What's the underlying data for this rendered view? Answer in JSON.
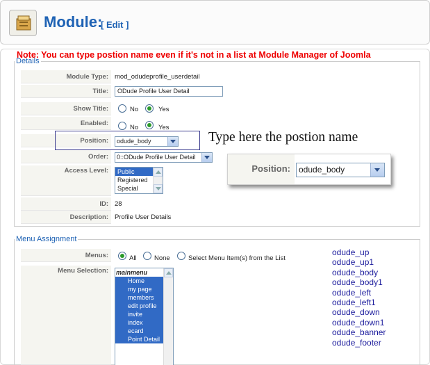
{
  "header": {
    "title": "Module:",
    "edit_tag": "[ Edit ]"
  },
  "note": "Note: You can type postion name even if it's not in a list at Module Manager of Joomla",
  "details": {
    "legend": "Details",
    "module_type": {
      "label": "Module Type:",
      "value": "mod_odudeprofile_userdetail"
    },
    "title": {
      "label": "Title:",
      "value": "ODude Profile User Detail"
    },
    "show_title": {
      "label": "Show Title:",
      "no": "No",
      "yes": "Yes",
      "selected": "Yes"
    },
    "enabled": {
      "label": "Enabled:",
      "no": "No",
      "yes": "Yes",
      "selected": "Yes"
    },
    "position": {
      "label": "Position:",
      "value": "odude_body"
    },
    "order": {
      "label": "Order:",
      "value": "0::ODude Profile User Detail"
    },
    "access_level": {
      "label": "Access Level:",
      "options": [
        "Public",
        "Registered",
        "Special"
      ],
      "selected": "Public"
    },
    "id": {
      "label": "ID:",
      "value": "28"
    },
    "description": {
      "label": "Description:",
      "value": "Profile User Details"
    }
  },
  "annotation": "Type here the postion name",
  "zoom": {
    "label": "Position:",
    "value": "odude_body"
  },
  "menu_assignment": {
    "legend": "Menu Assignment",
    "menus": {
      "label": "Menus:",
      "all": "All",
      "none": "None",
      "select": "Select Menu Item(s) from the List",
      "selected": "All"
    },
    "menu_selection": {
      "label": "Menu Selection:",
      "group": "mainmenu",
      "items": [
        "Home",
        "my page",
        "members",
        "edit profile",
        "invite",
        "index",
        "ecard",
        "Point Detail"
      ]
    }
  },
  "positions": [
    "odude_up",
    "odude_up1",
    "odude_body",
    "odude_body1",
    "odude_left",
    "odude_left1",
    "odude_down",
    "odude_down1",
    "odude_banner",
    "odude_footer"
  ],
  "colors": {
    "accent": "#1e62b4",
    "note": "#ee0000",
    "selection": "#316ac5",
    "position_text": "#1b1b9c"
  }
}
